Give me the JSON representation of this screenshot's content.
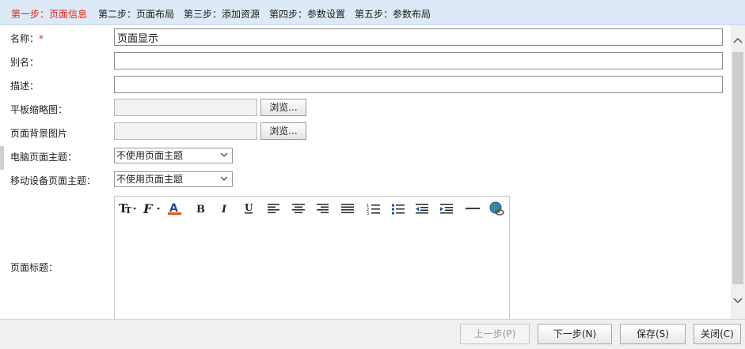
{
  "steps": [
    {
      "label": "第一步：页面信息",
      "active": true
    },
    {
      "label": "第二步：页面布局"
    },
    {
      "label": "第三步：添加资源"
    },
    {
      "label": "第四步：参数设置"
    },
    {
      "label": "第五步：参数布局"
    }
  ],
  "form": {
    "name_label": "名称：",
    "name_required": "*",
    "name_value": "页面显示",
    "alias_label": "别名：",
    "alias_value": "",
    "desc_label": "描述：",
    "desc_value": "",
    "tablet_thumb_label": "平板缩略图：",
    "bg_image_label": "页面背景图片",
    "browse_label": "浏览...",
    "pc_theme_label": "电脑页面主题：",
    "pc_theme_value": "不使用页面主题",
    "mobile_theme_label": "移动设备页面主题：",
    "mobile_theme_value": "不使用页面主题",
    "page_title_label": "页面标题："
  },
  "editor_toolbar": [
    "font-size-icon",
    "font-family-icon",
    "font-color-icon",
    "bold-icon",
    "italic-icon",
    "underline-icon",
    "align-left-icon",
    "align-center-icon",
    "align-right-icon",
    "justify-icon",
    "ordered-list-icon",
    "unordered-list-icon",
    "outdent-icon",
    "indent-icon",
    "horizontal-rule-icon",
    "link-globe-icon"
  ],
  "footer": {
    "prev_label": "上一步(P)",
    "next_label": "下一步(N)",
    "save_label": "保存(S)",
    "close_label": "关闭(C)"
  },
  "colors": {
    "active_step": "#e0261b",
    "step_bar": "#dde9f6",
    "font_color_bar": "#e8541e"
  }
}
